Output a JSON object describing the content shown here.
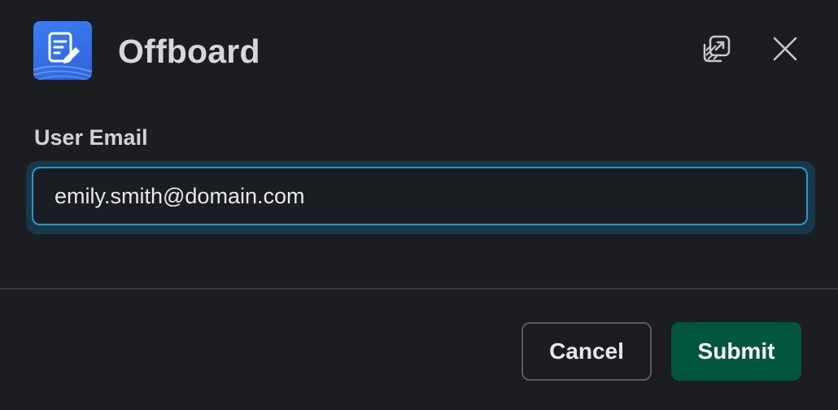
{
  "dialog": {
    "title": "Offboard",
    "app_icon": "document-pen-icon",
    "actions": {
      "popout_icon": "popout-window-icon",
      "close_icon": "close-icon"
    }
  },
  "form": {
    "email_label": "User Email",
    "email_value": "emily.smith@domain.com"
  },
  "footer": {
    "cancel_label": "Cancel",
    "submit_label": "Submit"
  },
  "colors": {
    "background": "#1b1d21",
    "focus_border": "#1d9bd1",
    "submit": "#00553d",
    "app_icon": "#3b7df5"
  }
}
